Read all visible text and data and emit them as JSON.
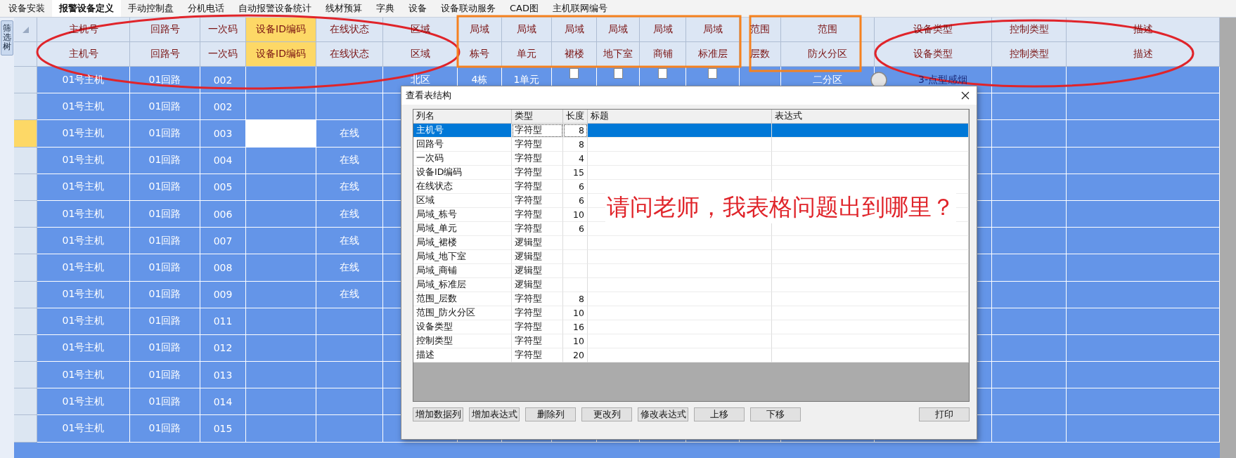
{
  "tabs": [
    {
      "label": "设备安装",
      "selected": false
    },
    {
      "label": "报警设备定义",
      "selected": true
    },
    {
      "label": "手动控制盘",
      "selected": false
    },
    {
      "label": "分机电话",
      "selected": false
    },
    {
      "label": "自动报警设备统计",
      "selected": false
    },
    {
      "label": "线材预算",
      "selected": false
    },
    {
      "label": "字典",
      "selected": false
    },
    {
      "label": "设备",
      "selected": false
    },
    {
      "label": "设备联动服务",
      "selected": false
    },
    {
      "label": "CAD图",
      "selected": false
    },
    {
      "label": "主机联网编号",
      "selected": false
    }
  ],
  "side_button": "筛选树",
  "grid": {
    "columns": [
      {
        "top": "主机号",
        "bottom": "主机号",
        "highlighted": false
      },
      {
        "top": "回路号",
        "bottom": "回路号",
        "highlighted": false
      },
      {
        "top": "一次码",
        "bottom": "一次码",
        "highlighted": false
      },
      {
        "top": "设备ID编码",
        "bottom": "设备ID编码",
        "highlighted": true
      },
      {
        "top": "在线状态",
        "bottom": "在线状态",
        "highlighted": false
      },
      {
        "top": "区域",
        "bottom": "区域",
        "highlighted": false
      },
      {
        "top": "局域",
        "bottom": "栋号",
        "highlighted": false
      },
      {
        "top": "局域",
        "bottom": "单元",
        "highlighted": false
      },
      {
        "top": "局域",
        "bottom": "裙楼",
        "highlighted": false
      },
      {
        "top": "局域",
        "bottom": "地下室",
        "highlighted": false
      },
      {
        "top": "局域",
        "bottom": "商铺",
        "highlighted": false
      },
      {
        "top": "局域",
        "bottom": "标准层",
        "highlighted": false
      },
      {
        "top": "范围",
        "bottom": "层数",
        "highlighted": false
      },
      {
        "top": "范围",
        "bottom": "防火分区",
        "highlighted": false
      },
      {
        "top": "设备类型",
        "bottom": "设备类型",
        "highlighted": false
      },
      {
        "top": "控制类型",
        "bottom": "控制类型",
        "highlighted": false
      },
      {
        "top": "描述",
        "bottom": "描述",
        "highlighted": false
      }
    ],
    "rows": [
      {
        "current": false,
        "host": "01号主机",
        "loop": "01回路",
        "code": "002",
        "zone": "北区",
        "building": "4栋",
        "unit": "1单元",
        "podium": false,
        "basement": false,
        "shops": false,
        "standard_floor": false,
        "fire_zone": "二分区",
        "device_type": "3-点型感烟"
      },
      {
        "current": false,
        "host": "01号主机",
        "loop": "01回路",
        "code": "002"
      },
      {
        "current": true,
        "host": "01号主机",
        "loop": "01回路",
        "code": "003",
        "online": "在线"
      },
      {
        "current": false,
        "host": "01号主机",
        "loop": "01回路",
        "code": "004",
        "online": "在线"
      },
      {
        "current": false,
        "host": "01号主机",
        "loop": "01回路",
        "code": "005",
        "online": "在线"
      },
      {
        "current": false,
        "host": "01号主机",
        "loop": "01回路",
        "code": "006",
        "online": "在线"
      },
      {
        "current": false,
        "host": "01号主机",
        "loop": "01回路",
        "code": "007",
        "online": "在线"
      },
      {
        "current": false,
        "host": "01号主机",
        "loop": "01回路",
        "code": "008",
        "online": "在线"
      },
      {
        "current": false,
        "host": "01号主机",
        "loop": "01回路",
        "code": "009",
        "online": "在线"
      },
      {
        "current": false,
        "host": "01号主机",
        "loop": "01回路",
        "code": "011"
      },
      {
        "current": false,
        "host": "01号主机",
        "loop": "01回路",
        "code": "012"
      },
      {
        "current": false,
        "host": "01号主机",
        "loop": "01回路",
        "code": "013"
      },
      {
        "current": false,
        "host": "01号主机",
        "loop": "01回路",
        "code": "014"
      },
      {
        "current": false,
        "host": "01号主机",
        "loop": "01回路",
        "code": "015"
      }
    ]
  },
  "dialog": {
    "title": "查看表结构",
    "columns": [
      "列名",
      "类型",
      "长度",
      "标题",
      "表达式"
    ],
    "rows": [
      {
        "name": "主机号",
        "type": "字符型",
        "length": "8",
        "selected": true
      },
      {
        "name": "回路号",
        "type": "字符型",
        "length": "8",
        "selected": false
      },
      {
        "name": "一次码",
        "type": "字符型",
        "length": "4",
        "selected": false
      },
      {
        "name": "设备ID编码",
        "type": "字符型",
        "length": "15",
        "selected": false
      },
      {
        "name": "在线状态",
        "type": "字符型",
        "length": "6",
        "selected": false
      },
      {
        "name": "区域",
        "type": "字符型",
        "length": "6",
        "selected": false
      },
      {
        "name": "局域_栋号",
        "type": "字符型",
        "length": "10",
        "selected": false
      },
      {
        "name": "局域_单元",
        "type": "字符型",
        "length": "6",
        "selected": false
      },
      {
        "name": "局域_裙楼",
        "type": "逻辑型",
        "selected": false
      },
      {
        "name": "局域_地下室",
        "type": "逻辑型",
        "selected": false
      },
      {
        "name": "局域_商铺",
        "type": "逻辑型",
        "selected": false
      },
      {
        "name": "局域_标准层",
        "type": "逻辑型",
        "selected": false
      },
      {
        "name": "范围_层数",
        "type": "字符型",
        "length": "8",
        "selected": false
      },
      {
        "name": "范围_防火分区",
        "type": "字符型",
        "length": "10",
        "selected": false
      },
      {
        "name": "设备类型",
        "type": "字符型",
        "length": "16",
        "selected": false
      },
      {
        "name": "控制类型",
        "type": "字符型",
        "length": "10",
        "selected": false
      },
      {
        "name": "描述",
        "type": "字符型",
        "length": "20",
        "selected": false
      }
    ],
    "buttons": [
      "增加数据列",
      "增加表达式",
      "删除列",
      "更改列",
      "修改表达式",
      "上移",
      "下移",
      "打印"
    ],
    "note": "请问老师，我表格问题出到哪里？"
  }
}
